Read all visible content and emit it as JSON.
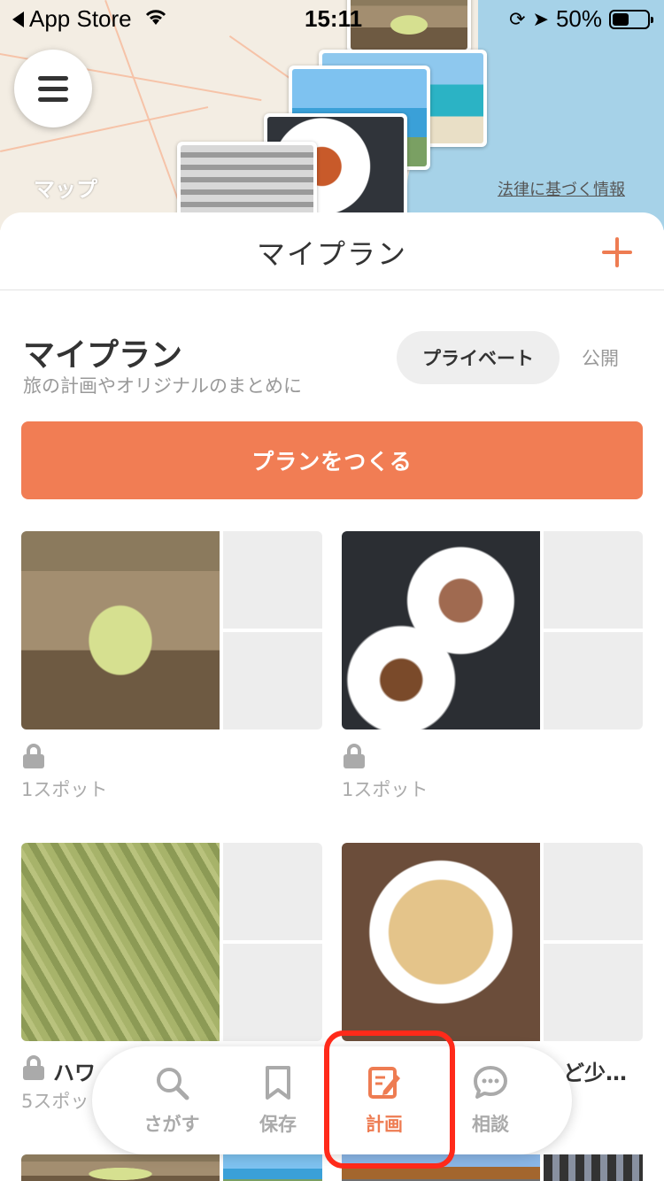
{
  "status_bar": {
    "back_label": "App Store",
    "time": "15:11",
    "battery": "50%"
  },
  "map": {
    "maps_label": "マップ",
    "legal_link": "法律に基づく情報"
  },
  "header": {
    "title": "マイプラン"
  },
  "section": {
    "title": "マイプラン",
    "subtitle": "旅の計画やオリジナルのまとめに",
    "segment_private": "プライベート",
    "segment_public": "公開"
  },
  "create_button": "プランをつくる",
  "plans": [
    {
      "spots": "1スポット"
    },
    {
      "spots": "1スポット"
    },
    {
      "name": "ハワ",
      "spots": "5スポッ"
    },
    {
      "name": "ど少…"
    }
  ],
  "tabs": [
    {
      "label": "さがす",
      "icon": "search-icon"
    },
    {
      "label": "保存",
      "icon": "bookmark-icon"
    },
    {
      "label": "計画",
      "icon": "edit-note-icon"
    },
    {
      "label": "相談",
      "icon": "chat-bubble-icon"
    }
  ],
  "colors": {
    "accent": "#f17d54",
    "highlight_outline": "#ff2a1a"
  }
}
